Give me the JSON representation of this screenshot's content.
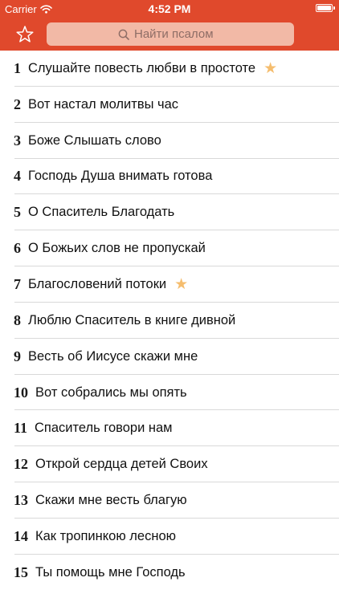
{
  "status_bar": {
    "carrier": "Carrier",
    "time": "4:52 PM"
  },
  "nav": {
    "favorites_icon": "star-outline-icon",
    "search": {
      "placeholder": "Найти псалом",
      "icon": "search-icon"
    }
  },
  "colors": {
    "header": "#e0492c",
    "search_field": "#f2b9a6",
    "favorite_star": "#f5bd6e"
  },
  "psalms": [
    {
      "number": "1",
      "title": "Слушайте повесть любви в простоте",
      "favorite": true
    },
    {
      "number": "2",
      "title": "Вот настал молитвы час",
      "favorite": false
    },
    {
      "number": "3",
      "title": "Боже Слышать слово",
      "favorite": false
    },
    {
      "number": "4",
      "title": "Господь Душа внимать готова",
      "favorite": false
    },
    {
      "number": "5",
      "title": "О Спаситель Благодать",
      "favorite": false
    },
    {
      "number": "6",
      "title": "О Божьих слов не пропускай",
      "favorite": false
    },
    {
      "number": "7",
      "title": "Благословений потоки",
      "favorite": true
    },
    {
      "number": "8",
      "title": "Люблю Спаситель в книге дивной",
      "favorite": false
    },
    {
      "number": "9",
      "title": "Весть об Иисусе скажи мне",
      "favorite": false
    },
    {
      "number": "10",
      "title": "Вот собрались мы опять",
      "favorite": false
    },
    {
      "number": "11",
      "title": "Спаситель говори нам",
      "favorite": false
    },
    {
      "number": "12",
      "title": "Открой сердца детей Своих",
      "favorite": false
    },
    {
      "number": "13",
      "title": "Скажи мне весть благую",
      "favorite": false
    },
    {
      "number": "14",
      "title": "Как тропинкою лесною",
      "favorite": false
    },
    {
      "number": "15",
      "title": "Ты помощь мне Господь",
      "favorite": false
    }
  ]
}
